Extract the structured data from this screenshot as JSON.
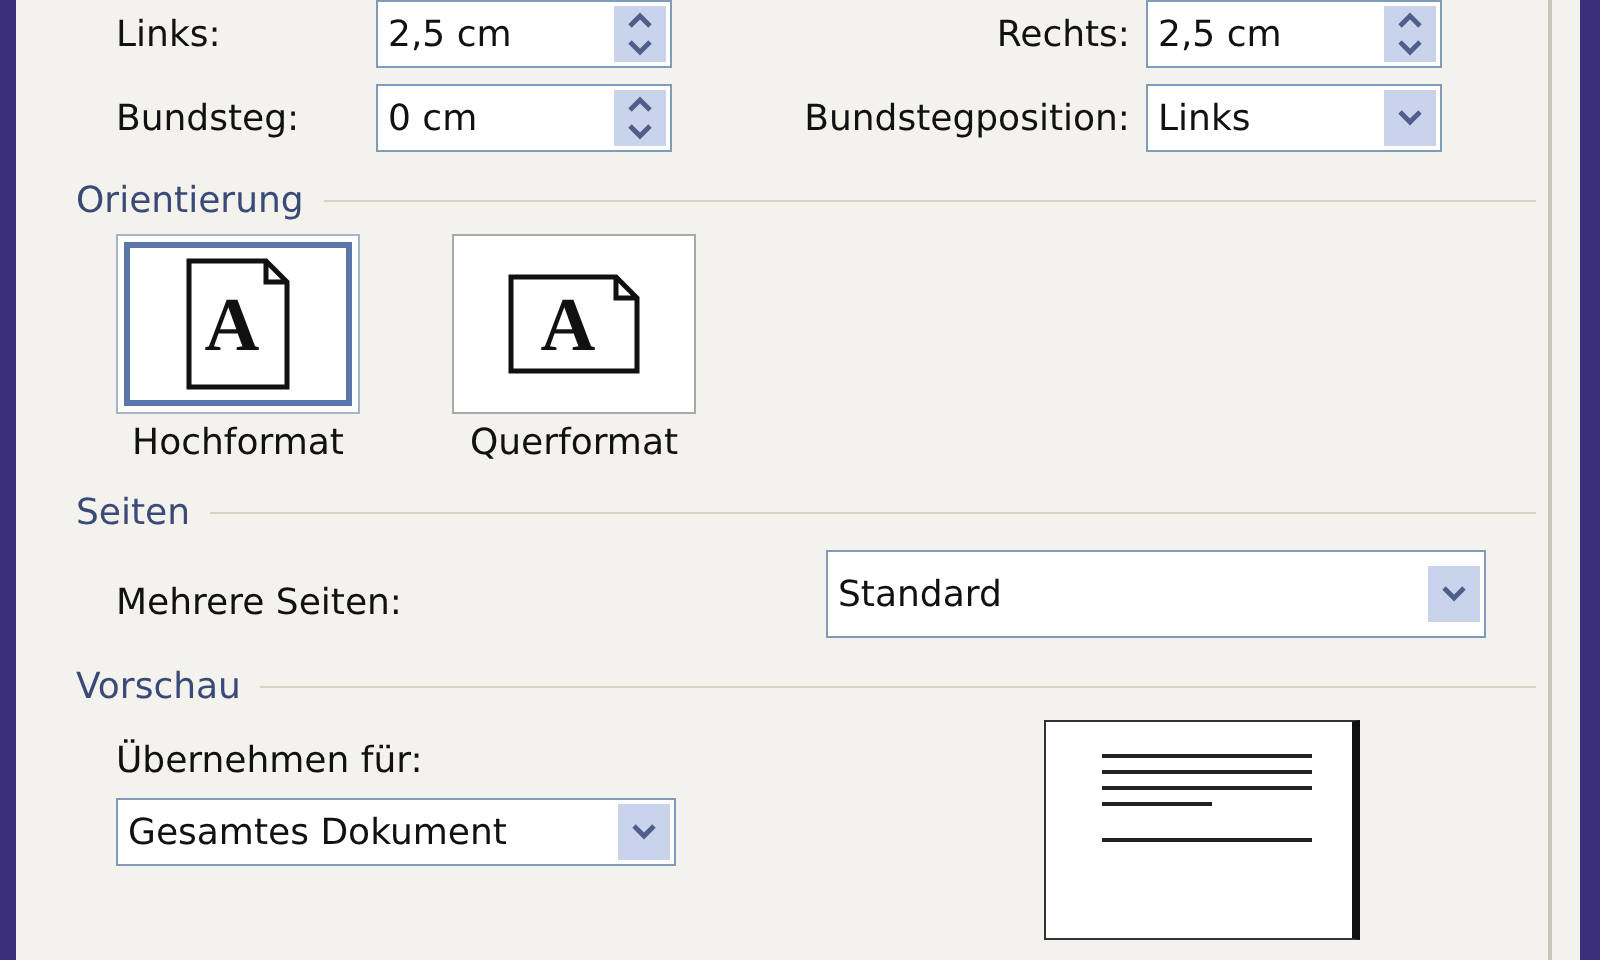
{
  "margins": [
    {
      "label": "Links:",
      "value": "2,5 cm",
      "kind": "spinner"
    },
    {
      "label": "Rechts:",
      "value": "2,5 cm",
      "kind": "spinner"
    },
    {
      "label": "Bundsteg:",
      "value": "0 cm",
      "kind": "spinner"
    },
    {
      "label": "Bundstegposition:",
      "value": "Links",
      "kind": "dropdown"
    }
  ],
  "orientation": {
    "title": "Orientierung",
    "options": [
      {
        "label": "Hochformat",
        "glyph": "A",
        "kind": "portrait",
        "selected": true
      },
      {
        "label": "Querformat",
        "glyph": "A",
        "kind": "landscape",
        "selected": false
      }
    ]
  },
  "pages": {
    "title": "Seiten",
    "label": "Mehrere Seiten:",
    "value": "Standard"
  },
  "preview": {
    "title": "Vorschau",
    "apply_label": "Übernehmen für:",
    "apply_value": "Gesamtes Dokument"
  }
}
